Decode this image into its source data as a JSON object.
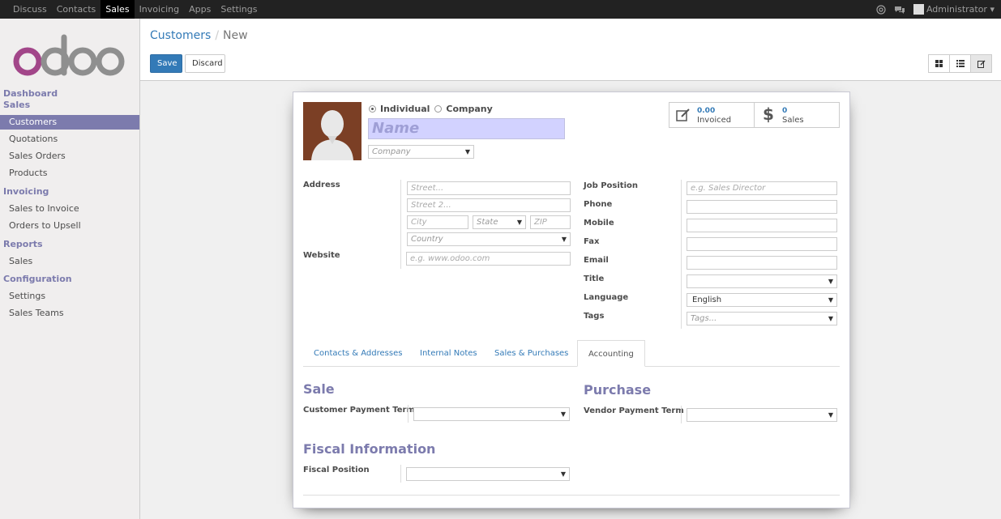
{
  "topbar": {
    "menu": [
      "Discuss",
      "Contacts",
      "Sales",
      "Invoicing",
      "Apps",
      "Settings"
    ],
    "active": "Sales",
    "user": "Administrator"
  },
  "sidebar": {
    "dashboard": "Dashboard",
    "sales_header": "Sales",
    "sales_items": [
      "Customers",
      "Quotations",
      "Sales Orders",
      "Products"
    ],
    "invoicing_header": "Invoicing",
    "invoicing_items": [
      "Sales to Invoice",
      "Orders to Upsell"
    ],
    "reports_header": "Reports",
    "reports_items": [
      "Sales"
    ],
    "config_header": "Configuration",
    "config_items": [
      "Settings",
      "Sales Teams"
    ]
  },
  "breadcrumb": {
    "parent": "Customers",
    "sep": "/",
    "current": "New"
  },
  "buttons": {
    "save": "Save",
    "discard": "Discard"
  },
  "form": {
    "radio_individual": "Individual",
    "radio_company": "Company",
    "name_placeholder": "Name",
    "company_placeholder": "Company",
    "stats": {
      "invoiced_value": "0.00",
      "invoiced_label": "Invoiced",
      "sales_value": "0",
      "sales_label": "Sales"
    },
    "address_label": "Address",
    "street_placeholder": "Street...",
    "street2_placeholder": "Street 2...",
    "city_placeholder": "City",
    "state_placeholder": "State",
    "zip_placeholder": "ZIP",
    "country_placeholder": "Country",
    "website_label": "Website",
    "website_placeholder": "e.g. www.odoo.com",
    "job_label": "Job Position",
    "job_placeholder": "e.g. Sales Director",
    "phone_label": "Phone",
    "mobile_label": "Mobile",
    "fax_label": "Fax",
    "email_label": "Email",
    "title_label": "Title",
    "language_label": "Language",
    "language_value": "English",
    "tags_label": "Tags",
    "tags_placeholder": "Tags..."
  },
  "tabs": [
    "Contacts & Addresses",
    "Internal Notes",
    "Sales & Purchases",
    "Accounting"
  ],
  "active_tab": "Accounting",
  "accounting": {
    "sale_header": "Sale",
    "customer_payment_term": "Customer Payment Term",
    "purchase_header": "Purchase",
    "vendor_payment_term": "Vendor Payment Term",
    "fiscal_header": "Fiscal Information",
    "fiscal_position": "Fiscal Position"
  },
  "colors": {
    "accent": "#7c7bad",
    "link": "#337ab7",
    "topbar": "#222222"
  }
}
